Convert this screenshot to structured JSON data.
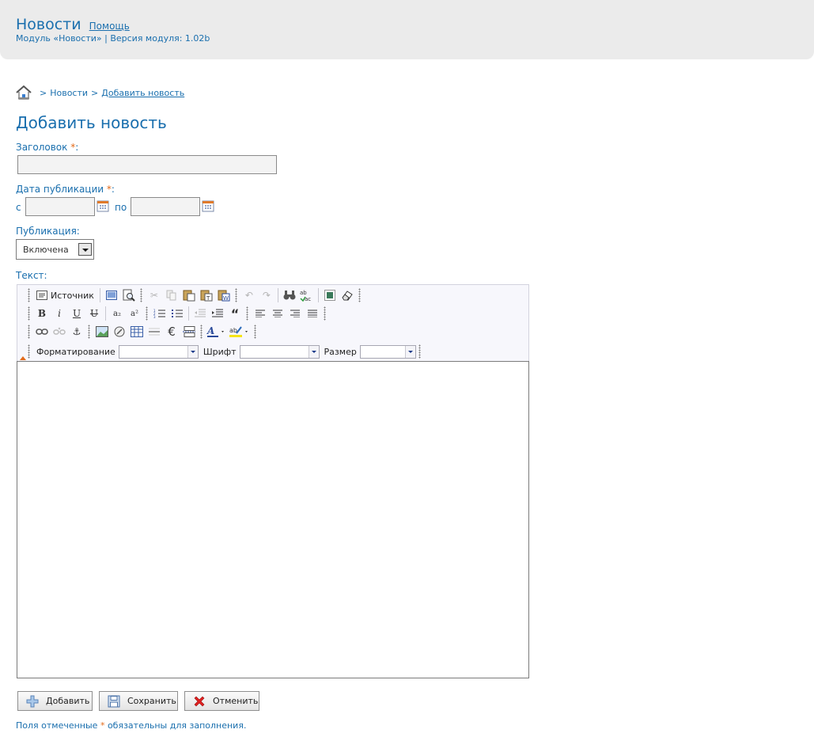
{
  "header": {
    "title": "Новости",
    "help": "Помощь",
    "subtitle": "Модуль «Новости» | Версия модуля: 1.02b"
  },
  "breadcrumb": {
    "sep1": ">",
    "item1": "Новости",
    "sep2": ">",
    "item2": "Добавить новость"
  },
  "page_title": "Добавить новость",
  "form": {
    "title_label": "Заголовок",
    "title_value": "",
    "required_mark": "*",
    "colon": ":",
    "date_label": "Дата публикации",
    "date_from_label": "с",
    "date_to_label": "по",
    "date_from_value": "",
    "date_to_value": "",
    "publication_label": "Публикация:",
    "publication_value": "Включена",
    "text_label": "Текст:"
  },
  "editor": {
    "source_label": "Источник",
    "format_label": "Форматирование",
    "font_label": "Шрифт",
    "size_label": "Размер",
    "bold": "B",
    "italic": "i",
    "underline": "U",
    "strike": "U",
    "subscript": "a₂",
    "superscript": "a²",
    "euro": "€",
    "content": ""
  },
  "buttons": {
    "add": "Добавить",
    "save": "Сохранить",
    "cancel": "Отменить"
  },
  "footnote": {
    "before": "Поля отмеченные",
    "mark": "*",
    "after": "обязательны для заполнения."
  },
  "colors": {
    "link": "#1a6fae",
    "required": "#e26b1b",
    "header_bg": "#ebebeb"
  }
}
